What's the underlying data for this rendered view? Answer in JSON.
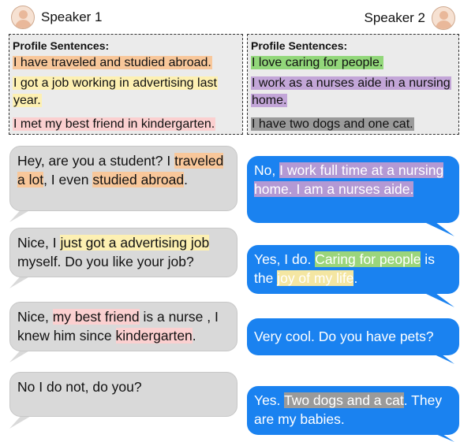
{
  "speakers": {
    "speaker1": "Speaker 1",
    "speaker2": "Speaker 2"
  },
  "profiles": {
    "title": "Profile Sentences:",
    "speaker1": [
      "I have traveled and studied abroad.",
      "I got a job working in advertising last year.",
      "I met my best friend in kindergarten."
    ],
    "speaker2": [
      "I love caring for people.",
      "I work as a nurses aide in a nursing home.",
      "I have two dogs and one cat."
    ]
  },
  "dialogue": {
    "m1": {
      "t1": "Hey, are you a student? I ",
      "h1": "traveled a lot",
      "t2": ", I even ",
      "h2": "studied abroad",
      "t3": "."
    },
    "m2": {
      "t1": "No, ",
      "h1": "I work full time at a nursing home. I am a nurses aide."
    },
    "m3": {
      "t1": "Nice, I ",
      "h1": "just got a advertising job",
      "t2": " myself. Do you like your job?"
    },
    "m4": {
      "t1": "Yes, I do. ",
      "h1": "Caring for people",
      "t2": " is the ",
      "h2": "joy of my life",
      "t3": "."
    },
    "m5": {
      "t1": "Nice, ",
      "h1": "my best friend",
      "t2": " is a nurse , I knew him since ",
      "h2": "kindergarten",
      "t3": "."
    },
    "m6": {
      "t1": "Very cool. Do you have pets?"
    },
    "m7": {
      "t1": "No I do not, do you?"
    },
    "m8": {
      "t1": "Yes. ",
      "h1": "Two dogs and a cat",
      "t2": ". They are my babies."
    }
  },
  "colors": {
    "left_bubble": "#d9d9d9",
    "right_bubble": "#1a82f0",
    "orange": "#f8c79a",
    "yellow": "#fdf0b2",
    "pink": "#fbd0d0",
    "green": "#92d77a",
    "purple": "#c3a6d8",
    "gray": "#9a9a9a"
  }
}
